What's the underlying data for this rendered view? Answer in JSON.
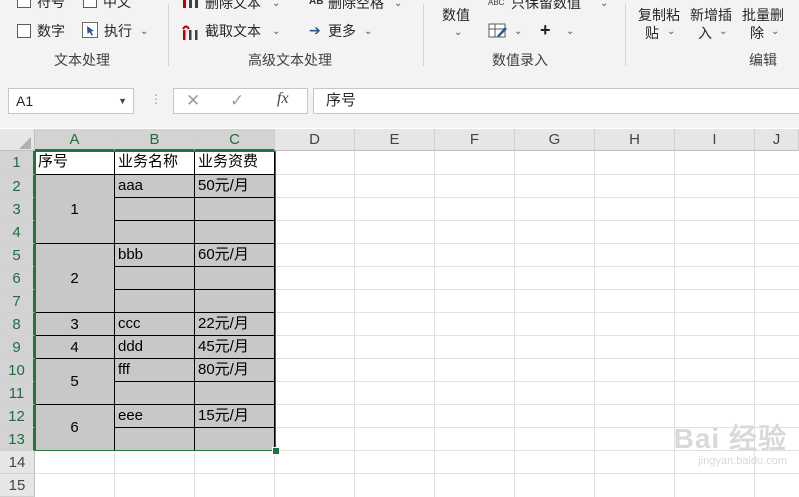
{
  "ribbon": {
    "text_group": {
      "items": [
        "符号",
        "中文",
        "数字",
        "执行"
      ],
      "label": "文本处理"
    },
    "adv_text_group": {
      "items": [
        "删除文本",
        "删除空格",
        "截取文本",
        "更多"
      ],
      "label": "高级文本处理"
    },
    "num_group": {
      "items": [
        "数值",
        "只保留数值"
      ],
      "label": "数值录入"
    },
    "edit_group": {
      "copy_paste": [
        "复制粘",
        "贴"
      ],
      "insert": [
        "新增插",
        "入"
      ],
      "batch_delete": [
        "批量删",
        "除"
      ],
      "label": "编辑"
    }
  },
  "formula_bar": {
    "name_box": "A1",
    "fx": "fx",
    "formula": "序号"
  },
  "columns": [
    "A",
    "B",
    "C",
    "D",
    "E",
    "F",
    "G",
    "H",
    "I",
    "J"
  ],
  "rows": [
    "1",
    "2",
    "3",
    "4",
    "5",
    "6",
    "7",
    "8",
    "9",
    "10",
    "11",
    "12",
    "13",
    "14",
    "15"
  ],
  "table": {
    "headers": [
      "序号",
      "业务名称",
      "业务资费"
    ],
    "a_merged": [
      "1",
      "2",
      "3",
      "4",
      "5",
      "6"
    ],
    "b_values": [
      "aaa",
      "",
      "",
      "bbb",
      "",
      "",
      "ccc",
      "ddd",
      "fff",
      "",
      "eee",
      ""
    ],
    "c_values": [
      "50元/月",
      "",
      "",
      "60元/月",
      "",
      "",
      "22元/月",
      "45元/月",
      "80元/月",
      "",
      "15元/月",
      ""
    ]
  },
  "watermark": {
    "brand": "Bai  经验",
    "url": "jingyan.baidu.com"
  }
}
